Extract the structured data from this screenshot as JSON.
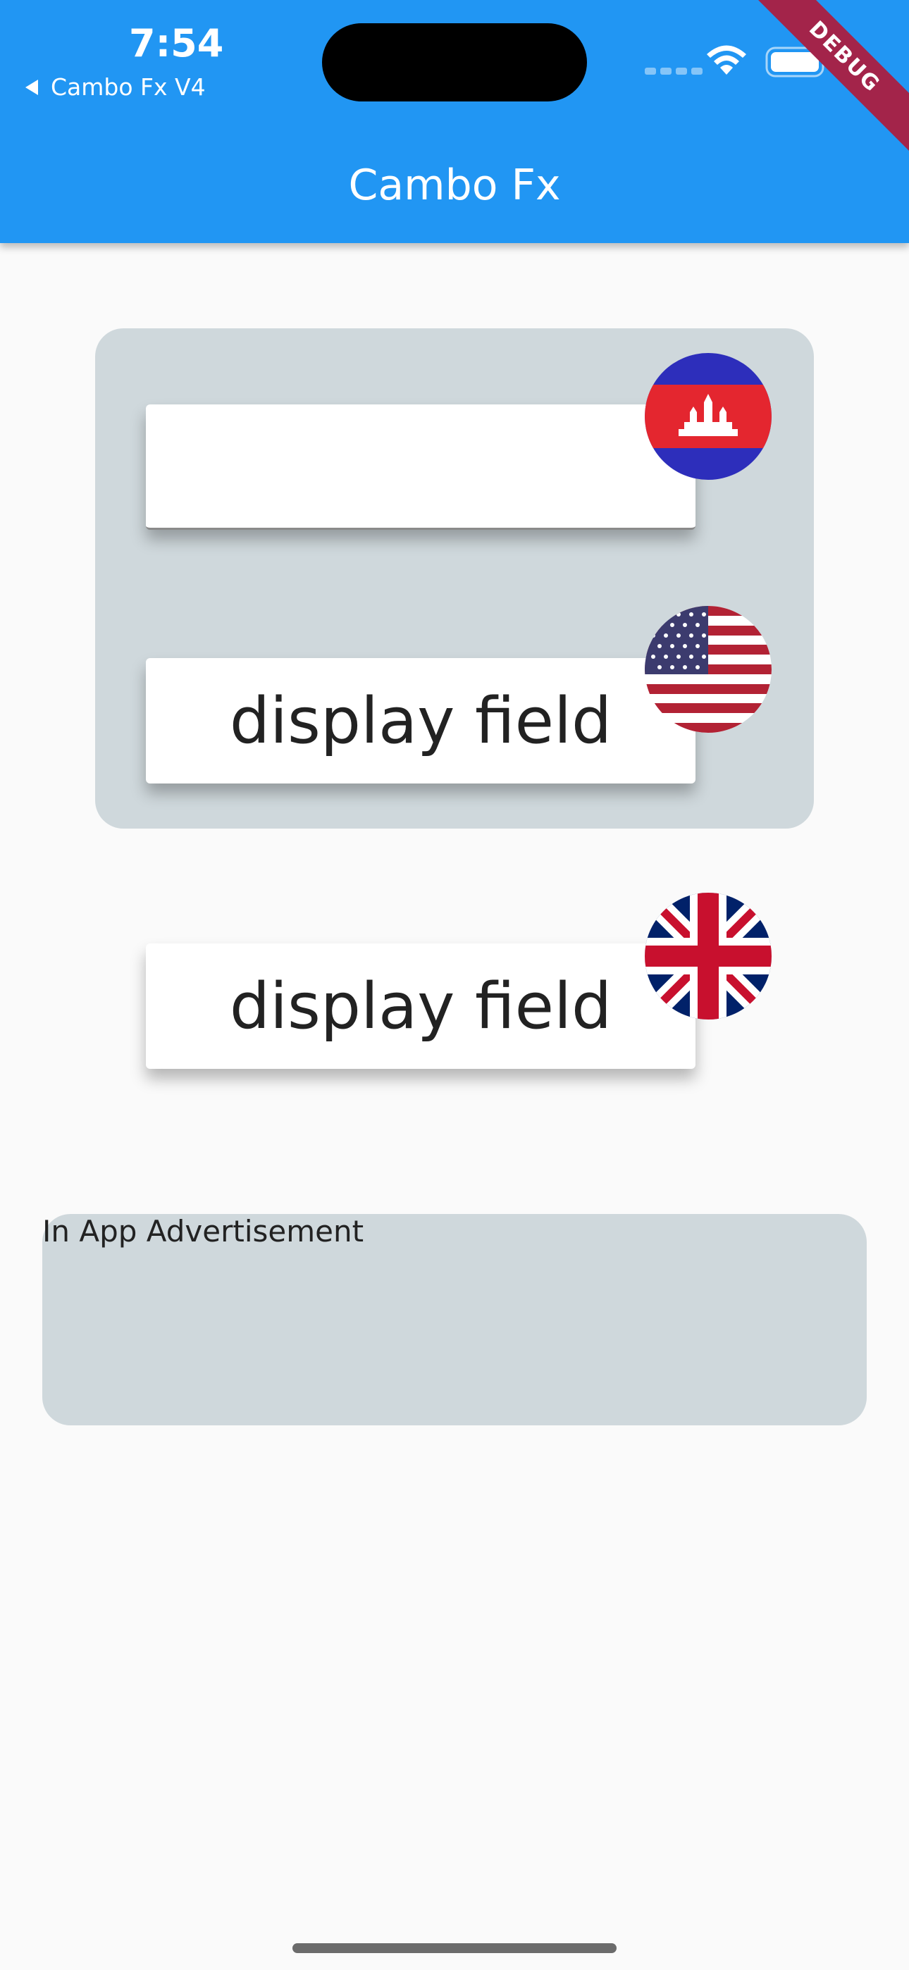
{
  "status_bar": {
    "time": "7:54",
    "back_app": "Cambo Fx V4"
  },
  "app_bar": {
    "title": "Cambo Fx"
  },
  "debug_banner": "DEBUG",
  "converter": {
    "khr_field": {
      "value": "",
      "flag": "cambodia-flag"
    },
    "usd_field": {
      "value": "display field",
      "flag": "usa-flag"
    },
    "gbp_field": {
      "value": "display field",
      "flag": "uk-flag"
    }
  },
  "ad": {
    "label": "In App Advertisement"
  },
  "colors": {
    "app_bar": "#2196f3",
    "panel": "#cfd8dc",
    "background": "#fafafa",
    "debug_ribbon": "#a3244a"
  }
}
